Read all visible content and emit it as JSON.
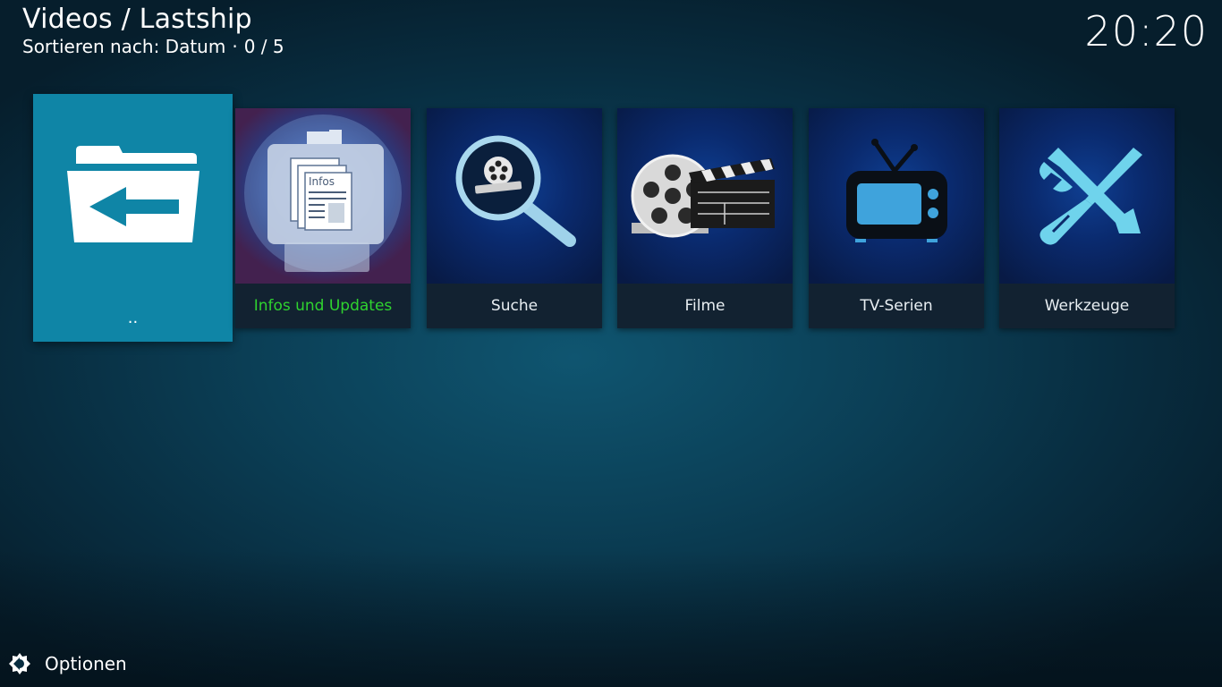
{
  "header": {
    "title": "Videos / Lastship",
    "sort_label": "Sortieren nach: Datum",
    "separator": "·",
    "count": "0 / 5"
  },
  "clock": "20:20",
  "items": [
    {
      "label": "..",
      "icon": "folder-back-icon",
      "selected": true
    },
    {
      "label": "Infos und Updates",
      "icon": "infos-document-icon",
      "highlight_color": "#2fd32f",
      "icon_text": "Infos"
    },
    {
      "label": "Suche",
      "icon": "magnifier-film-reel-icon"
    },
    {
      "label": "Filme",
      "icon": "film-reel-clapperboard-icon"
    },
    {
      "label": "TV-Serien",
      "icon": "tv-icon"
    },
    {
      "label": "Werkzeuge",
      "icon": "tools-wrench-screwdriver-icon"
    }
  ],
  "footer": {
    "options_label": "Optionen",
    "options_icon": "settings-gear-icon"
  },
  "colors": {
    "selected_tile": "#0f85a6",
    "highlight_label": "#2fd32f",
    "background": "#0b3f56"
  }
}
